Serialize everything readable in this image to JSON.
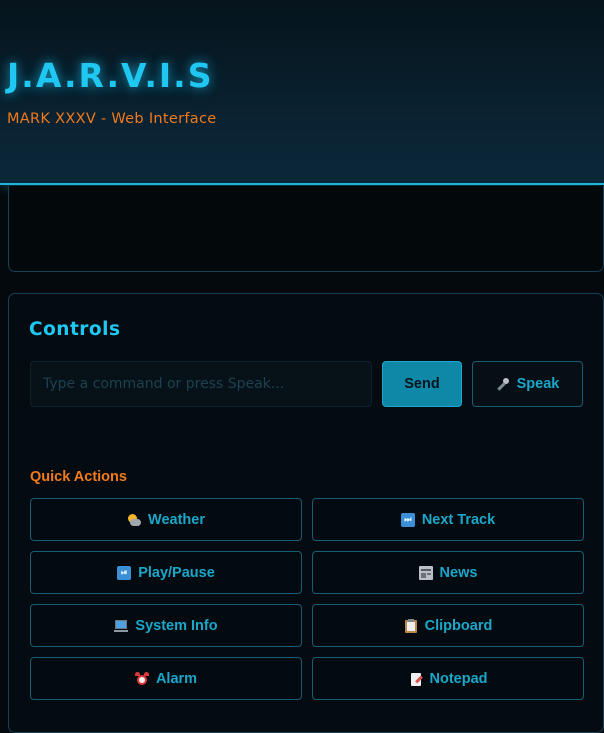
{
  "header": {
    "title": "J.A.R.V.I.S",
    "subtitle": "MARK XXXV - Web Interface"
  },
  "controls": {
    "title": "Controls",
    "input": {
      "placeholder": "Type a command or press Speak...",
      "value": ""
    },
    "send_label": "Send",
    "speak_label": "Speak",
    "speak_icon": "microphone-icon"
  },
  "quick_actions": {
    "title": "Quick Actions",
    "items": [
      {
        "label": "Weather",
        "icon": "weather-icon"
      },
      {
        "label": "Next Track",
        "icon": "next-track-icon"
      },
      {
        "label": "Play/Pause",
        "icon": "play-pause-icon"
      },
      {
        "label": "News",
        "icon": "newspaper-icon"
      },
      {
        "label": "System Info",
        "icon": "laptop-icon"
      },
      {
        "label": "Clipboard",
        "icon": "clipboard-icon"
      },
      {
        "label": "Alarm",
        "icon": "alarm-clock-icon"
      },
      {
        "label": "Notepad",
        "icon": "notepad-icon"
      }
    ]
  },
  "colors": {
    "accent": "#1ec8f2",
    "secondary": "#f07a1c",
    "button_primary": "#0f88a8",
    "border": "#175d76",
    "background": "#04090d"
  }
}
